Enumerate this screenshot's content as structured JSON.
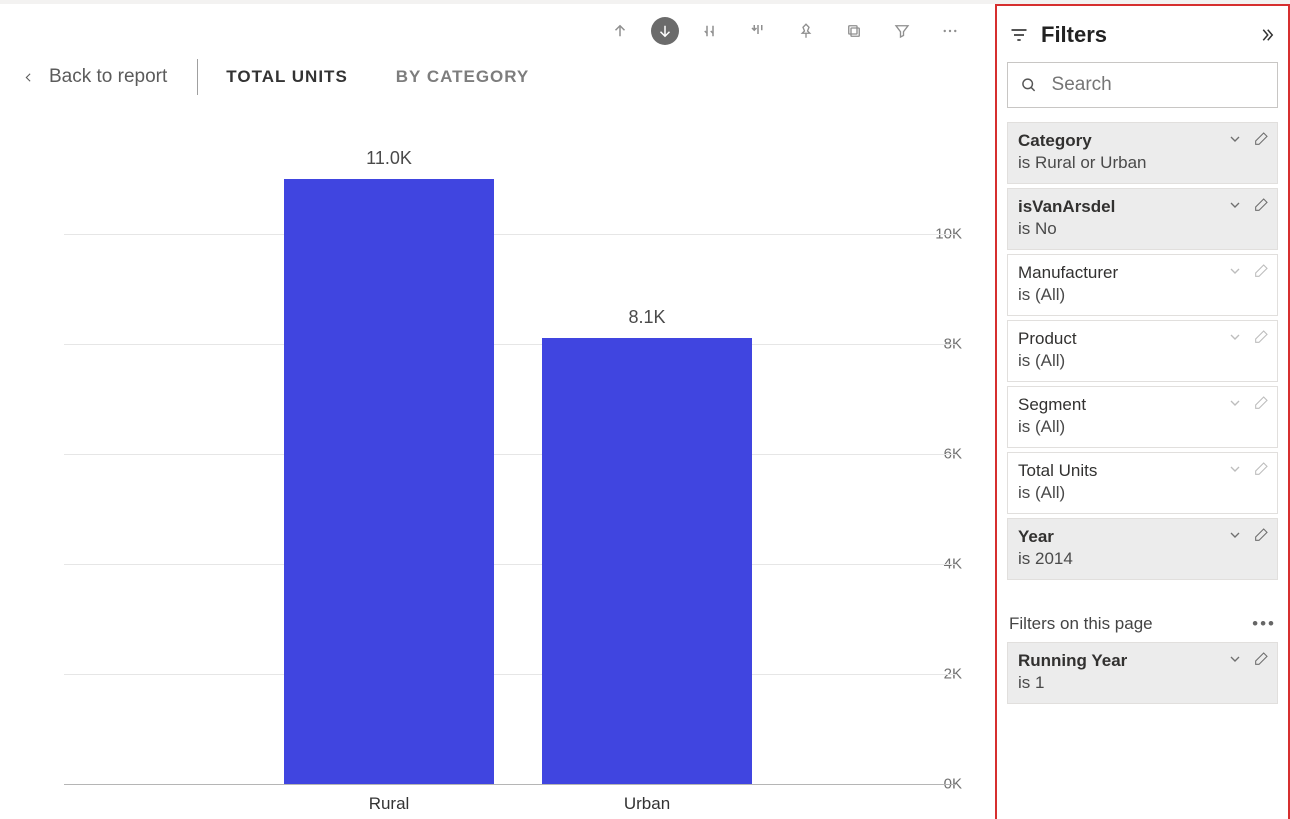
{
  "header": {
    "back_label": "Back to report",
    "tabs": [
      {
        "label": "TOTAL UNITS",
        "active": true
      },
      {
        "label": "BY CATEGORY",
        "active": false
      }
    ]
  },
  "toolbar": {
    "icons": [
      "drill-up",
      "drill-down-active",
      "expand-next",
      "expand-all",
      "pin",
      "focus-mode",
      "filter-icon",
      "more"
    ]
  },
  "chart_data": {
    "type": "bar",
    "categories": [
      "Rural",
      "Urban"
    ],
    "values": [
      11000,
      8100
    ],
    "value_labels": [
      "11.0K",
      "8.1K"
    ],
    "ylabel": "",
    "xlabel": "",
    "y_ticks": [
      0,
      2000,
      4000,
      6000,
      8000,
      10000
    ],
    "y_tick_labels": [
      "0K",
      "2K",
      "4K",
      "6K",
      "8K",
      "10K"
    ],
    "ylim": [
      0,
      11500
    ],
    "bar_color": "#4045e0"
  },
  "filters": {
    "title": "Filters",
    "search_placeholder": "Search",
    "visual": [
      {
        "name": "Category",
        "value": "is Rural or Urban",
        "applied": true
      },
      {
        "name": "isVanArsdel",
        "value": "is No",
        "applied": true
      },
      {
        "name": "Manufacturer",
        "value": "is (All)",
        "applied": false
      },
      {
        "name": "Product",
        "value": "is (All)",
        "applied": false
      },
      {
        "name": "Segment",
        "value": "is (All)",
        "applied": false
      },
      {
        "name": "Total Units",
        "value": "is (All)",
        "applied": false
      },
      {
        "name": "Year",
        "value": "is 2014",
        "applied": true
      }
    ],
    "page_section_label": "Filters on this page",
    "page": [
      {
        "name": "Running Year",
        "value": "is 1",
        "applied": true
      }
    ]
  }
}
